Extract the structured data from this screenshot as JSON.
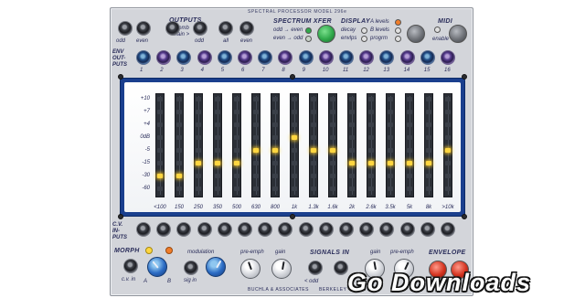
{
  "module": {
    "title": "SPECTRAL PROCESSOR MODEL 296e",
    "maker": "BUCHLA & ASSOCIATES",
    "city_partial": "BERKELEY"
  },
  "outputs": {
    "header": "OUTPUTS",
    "sub1": "< comb",
    "sub2": "main >",
    "jack_labels": [
      "odd",
      "even",
      "odd",
      "all",
      "even"
    ]
  },
  "spectrum_xfer": {
    "header": "SPECTRUM XFER",
    "row1": "odd → even",
    "row2": "even → odd"
  },
  "display": {
    "header": "DISPLAY",
    "left": [
      "decay",
      "envlps"
    ],
    "right": [
      "A levels",
      "B levels",
      "progrm"
    ]
  },
  "midi": {
    "header": "MIDI",
    "enable": "enable"
  },
  "env_outputs": {
    "label": [
      "ENV",
      "OUT-",
      "PUTS"
    ],
    "numbers": [
      "1",
      "2",
      "3",
      "4",
      "5",
      "6",
      "7",
      "8",
      "9",
      "10",
      "11",
      "12",
      "13",
      "14",
      "15",
      "16"
    ]
  },
  "spectrum": {
    "db_scale": [
      "+10",
      "+7",
      "+4",
      "0dB",
      "-5",
      "-15",
      "-30",
      "-60"
    ],
    "bands": [
      "<100",
      "150",
      "250",
      "350",
      "500",
      "630",
      "800",
      "1k",
      "1.3k",
      "1.6k",
      "2k",
      "2.6k",
      "3.5k",
      "5k",
      "8k",
      ">10k"
    ],
    "levels_db": [
      -30,
      -30,
      -15,
      -15,
      -15,
      -5,
      -5,
      0,
      -5,
      -5,
      -15,
      -15,
      -15,
      -15,
      -15,
      -5
    ]
  },
  "cv_inputs": {
    "label": [
      "C.V.",
      "IN-",
      "PUTS"
    ]
  },
  "bottom": {
    "morph": "MORPH",
    "morph_a": "A",
    "morph_b": "B",
    "cv_in": "c.v. in",
    "modulation": "modulation",
    "sig_in": "sig in",
    "pre_emph_1": "pre-emph",
    "gain_1": "gain",
    "signals_in": "SIGNALS IN",
    "odd": "< odd",
    "gain_2": "gain",
    "pre_emph_2": "pre-emph",
    "envelope": "ENVELOPE"
  },
  "watermark": "Go Downloads",
  "colors": {
    "panel": "#d3d5da",
    "screen_frame": "#1a3f8e",
    "lamp_on": "#ffd640",
    "ink": "#2a2d5a",
    "button_green": "#2fa84a",
    "button_grey": "#6f7278"
  }
}
